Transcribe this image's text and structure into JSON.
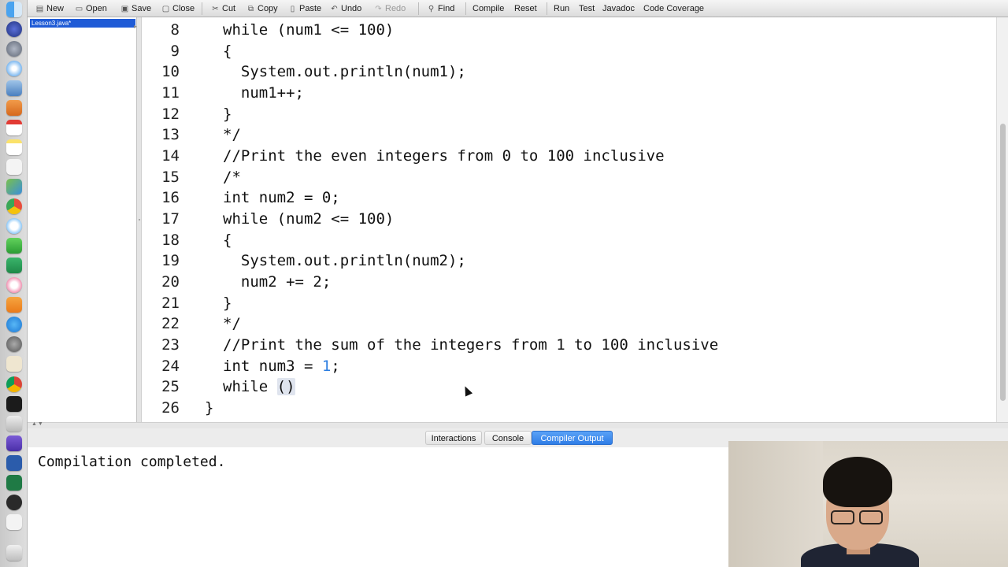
{
  "toolbar": {
    "new": "New",
    "open": "Open",
    "save": "Save",
    "close": "Close",
    "cut": "Cut",
    "copy": "Copy",
    "paste": "Paste",
    "undo": "Undo",
    "redo": "Redo",
    "find": "Find",
    "compile": "Compile",
    "reset": "Reset",
    "run": "Run",
    "test": "Test",
    "javadoc": "Javadoc",
    "coverage": "Code Coverage"
  },
  "files": {
    "open_file": "Lesson3.java*"
  },
  "editor": {
    "lines": [
      {
        "n": "8",
        "code": "while (num1 <= 100)"
      },
      {
        "n": "9",
        "code": "{"
      },
      {
        "n": "10",
        "code": "  System.out.println(num1);"
      },
      {
        "n": "11",
        "code": "  num1++;"
      },
      {
        "n": "12",
        "code": "}"
      },
      {
        "n": "13",
        "code": "*/"
      },
      {
        "n": "14",
        "code": "//Print the even integers from 0 to 100 inclusive"
      },
      {
        "n": "15",
        "code": "/*"
      },
      {
        "n": "16",
        "code": "int num2 = 0;"
      },
      {
        "n": "17",
        "code": "while (num2 <= 100)"
      },
      {
        "n": "18",
        "code": "{"
      },
      {
        "n": "19",
        "code": "  System.out.println(num2);"
      },
      {
        "n": "20",
        "code": "  num2 += 2;"
      },
      {
        "n": "21",
        "code": "}"
      },
      {
        "n": "22",
        "code": "*/"
      },
      {
        "n": "23",
        "code": "//Print the sum of the integers from 1 to 100 inclusive"
      },
      {
        "n": "24",
        "code_pre": "int num3 = ",
        "code_num": "1",
        "code_post": ";"
      },
      {
        "n": "25",
        "code_pre": "while ",
        "code_paren": "()"
      },
      {
        "n": "26",
        "code": "}"
      }
    ]
  },
  "tabs": {
    "interactions": "Interactions",
    "console": "Console",
    "compiler_output": "Compiler Output"
  },
  "output": {
    "text": "Compilation completed."
  },
  "colors": {
    "accent": "#2f7de6",
    "number": "#2a7de1",
    "selection": "#1f5bd6"
  }
}
